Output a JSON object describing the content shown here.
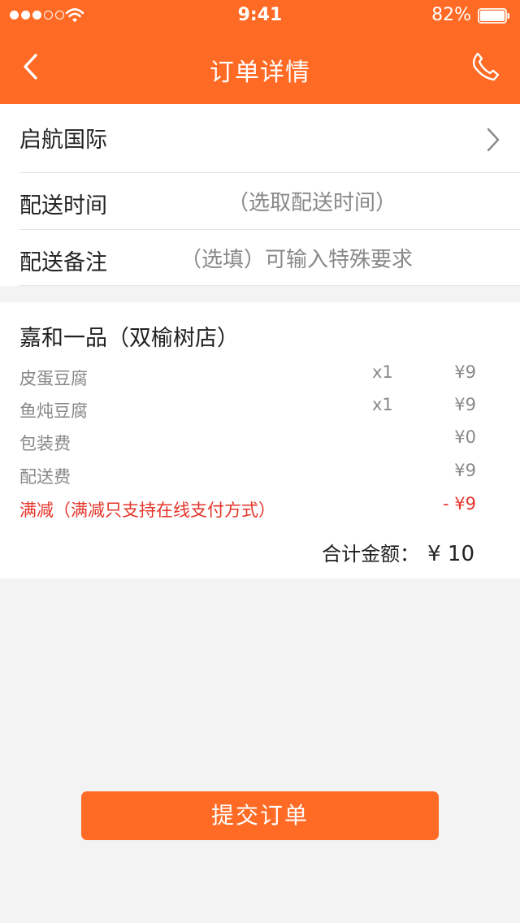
{
  "status_bar": {
    "time": "9:41",
    "battery_percent": "82%",
    "battery_level": 0.82,
    "signal_bars_filled": 3,
    "signal_bars_total": 5
  },
  "nav": {
    "title": "订单详情",
    "back_icon": "chevron-left-icon",
    "phone_icon": "phone-icon"
  },
  "info": {
    "address": "启航国际",
    "delivery_time_label": "配送时间",
    "delivery_time_placeholder": "（选取配送时间）",
    "note_label": "配送备注",
    "note_placeholder": "（选填）可输入特殊要求"
  },
  "order": {
    "shop_name": "嘉和一品（双榆树店）",
    "items": [
      {
        "name": "皮蛋豆腐",
        "qty": "x1",
        "price": "¥9"
      },
      {
        "name": "鱼炖豆腐",
        "qty": "x1",
        "price": "¥9"
      }
    ],
    "packaging_label": "包装费",
    "packaging_price": "¥0",
    "delivery_fee_label": "配送费",
    "delivery_fee_price": "¥9",
    "discount_label": "满减（满减只支持在线支付方式）",
    "discount_price": "- ¥9",
    "total_label": "合计金额：",
    "total_amount": "¥ 10"
  },
  "submit_label": "提交订单",
  "colors": {
    "accent": "#ff6a24",
    "discount": "#e5342a",
    "background": "#f3f3f3"
  }
}
